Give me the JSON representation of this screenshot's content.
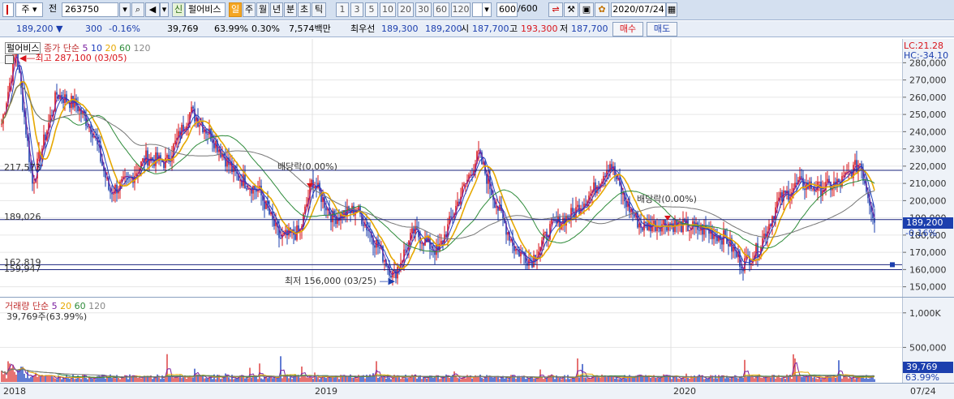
{
  "toolbar": {
    "type_label": "주",
    "period_label": "전",
    "code": "263750",
    "news_badge": "신",
    "stock_name": "펄어비스",
    "unit_active": "일",
    "units": [
      "주",
      "월",
      "년",
      "분",
      "초",
      "틱"
    ],
    "intervals": [
      "1",
      "3",
      "5",
      "10",
      "20",
      "30",
      "60",
      "120"
    ],
    "count": "600",
    "count_total": "/600",
    "date": "2020/07/24"
  },
  "quote": {
    "price": "189,200",
    "change": "300",
    "change_pct": "-0.16%",
    "volume": "39,769",
    "volume_ratio": "63.99%",
    "turnover": "0.30%",
    "amount": "7,574백만",
    "best_bid_label": "최우선",
    "best_ask": "189,300",
    "best_bid": "189,200",
    "open_label": "시",
    "open": "187,700",
    "high": "193,300",
    "low_label": "저",
    "low": "187,700",
    "buy_label": "매수",
    "sell_label": "매도"
  },
  "price_pane": {
    "legend_name": "펄어비스",
    "legend_ma": "종가 단순",
    "ma_periods": [
      "5",
      "10",
      "20",
      "60",
      "120"
    ],
    "ma_colors": [
      "#7a1fa0",
      "#1f3fbf",
      "#e6a800",
      "#2e8b3a",
      "#777777"
    ],
    "lc": "LC:21.28",
    "hc": "HC:-34.10",
    "high_note": "최고 287,100 (03/05)",
    "low_note": "최저 156,000 (03/25)",
    "dividend_1": "배당락(0.00%)",
    "dividend_2": "배당락(0.00%)",
    "level_1": "217,573",
    "level_2": "189,026",
    "level_3": "162,819",
    "level_4": "159,947",
    "current_price_tag": "189,200",
    "current_pct_tag": "-0.16%"
  },
  "volume_pane": {
    "legend_name": "거래량",
    "legend_ma": "단순",
    "ma_periods": [
      "5",
      "20",
      "60",
      "120"
    ],
    "current": "39,769주(63.99%)",
    "current_tag": "39,769",
    "current_pct_tag": "63.99%"
  },
  "x_axis_labels": [
    "2018",
    "2019",
    "2020",
    "07/24"
  ],
  "chart_data": {
    "type": "candlestick",
    "y_ticks": [
      150000,
      160000,
      170000,
      180000,
      190000,
      200000,
      210000,
      220000,
      230000,
      240000,
      250000,
      260000,
      270000,
      280000
    ],
    "y_tick_labels": [
      "150,000",
      "160,000",
      "170,000",
      "180,000",
      "190,000",
      "200,000",
      "210,000",
      "220,000",
      "230,000",
      "240,000",
      "250,000",
      "260,000",
      "270,000",
      "280,000"
    ],
    "ylim": [
      147000,
      291000
    ],
    "volume_ticks": [
      "1,000K",
      "500,000"
    ],
    "volume_tick_values": [
      1000000,
      500000
    ],
    "volume_ylim": [
      0,
      1150000
    ],
    "period": [
      "2018",
      "07/24"
    ],
    "close_path": [
      [
        0,
        240000
      ],
      [
        20,
        287100
      ],
      [
        40,
        210000
      ],
      [
        70,
        262000
      ],
      [
        95,
        255000
      ],
      [
        115,
        240000
      ],
      [
        135,
        205000
      ],
      [
        160,
        212000
      ],
      [
        180,
        225000
      ],
      [
        205,
        222000
      ],
      [
        235,
        252000
      ],
      [
        260,
        238000
      ],
      [
        290,
        215000
      ],
      [
        320,
        205000
      ],
      [
        345,
        178000
      ],
      [
        370,
        182000
      ],
      [
        385,
        212000
      ],
      [
        410,
        190000
      ],
      [
        440,
        195000
      ],
      [
        470,
        170000
      ],
      [
        485,
        156000
      ],
      [
        510,
        182000
      ],
      [
        540,
        170000
      ],
      [
        565,
        200000
      ],
      [
        590,
        227000
      ],
      [
        610,
        200000
      ],
      [
        635,
        172000
      ],
      [
        655,
        165000
      ],
      [
        680,
        185000
      ],
      [
        705,
        192000
      ],
      [
        730,
        205000
      ],
      [
        752,
        222000
      ],
      [
        770,
        200000
      ],
      [
        790,
        185000
      ],
      [
        820,
        187000
      ],
      [
        845,
        185000
      ],
      [
        870,
        183000
      ],
      [
        895,
        178000
      ],
      [
        915,
        163000
      ],
      [
        935,
        172000
      ],
      [
        960,
        200000
      ],
      [
        985,
        210000
      ],
      [
        1010,
        207000
      ],
      [
        1035,
        210000
      ],
      [
        1060,
        222000
      ],
      [
        1078,
        189200
      ]
    ]
  }
}
